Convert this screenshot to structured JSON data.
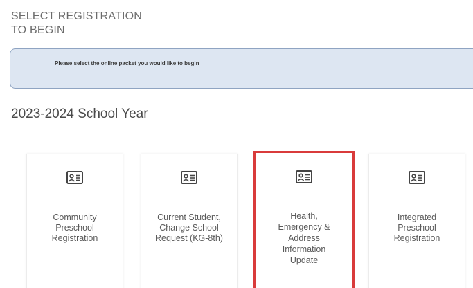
{
  "header": {
    "title_line1": "SELECT REGISTRATION",
    "title_line2": "TO BEGIN"
  },
  "banner": {
    "message": "Please select the online packet you would like to begin"
  },
  "section": {
    "heading": "2023-2024 School Year"
  },
  "cards": [
    {
      "icon": "id-card-icon",
      "lines": [
        "Community",
        "Preschool",
        "Registration"
      ],
      "selected": false
    },
    {
      "icon": "id-card-icon",
      "lines": [
        "Current Student,",
        "Change School",
        "Request (KG-8th)"
      ],
      "selected": false
    },
    {
      "icon": "id-card-icon",
      "lines": [
        "Health,",
        "Emergency &",
        "Address",
        "Information",
        "Update"
      ],
      "selected": true
    },
    {
      "icon": "id-card-icon",
      "lines": [
        "Integrated",
        "Preschool",
        "Registration"
      ],
      "selected": false
    }
  ],
  "colors": {
    "selected_border": "#d93b3b",
    "banner_bg": "#dde6f2",
    "banner_border": "#8fa4c2"
  }
}
